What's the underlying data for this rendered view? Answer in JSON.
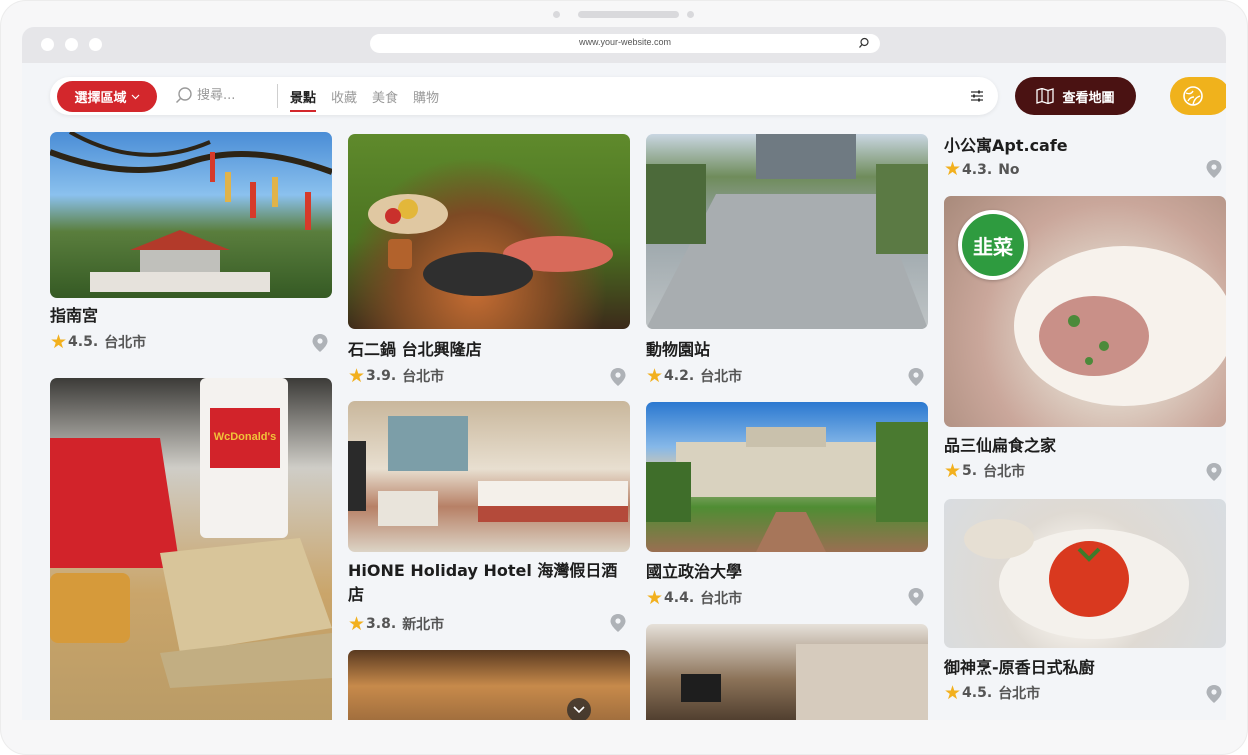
{
  "browser": {
    "url": "www.your-website.com"
  },
  "toolbar": {
    "region_button": "選擇區域",
    "search_placeholder": "搜尋...",
    "tabs": [
      {
        "label": "景點"
      },
      {
        "label": "收藏"
      },
      {
        "label": "美食"
      },
      {
        "label": "購物"
      }
    ],
    "map_button": "查看地圖"
  },
  "colors": {
    "accent_red": "#d3272c",
    "map_button": "#4a1212",
    "yellow_button": "#f0b21c",
    "star": "#f2b01e",
    "badge_green": "#2e9b3f"
  },
  "cards": [
    {
      "title": "指南宮",
      "rating": "4.5",
      "sep": ".",
      "city": "台北市"
    },
    {
      "title": "石二鍋 台北興隆店",
      "rating": "3.9",
      "sep": ".",
      "city": "台北市"
    },
    {
      "title": "動物園站",
      "rating": "4.2",
      "sep": ".",
      "city": "台北市"
    },
    {
      "title": "小公寓Apt.cafe",
      "rating": "4.3",
      "sep": ".",
      "city": "No"
    },
    {
      "title": "HiONE Holiday Hotel 海灣假日酒店",
      "rating": "3.8",
      "sep": ".",
      "city": "新北市"
    },
    {
      "title": "國立政治大學",
      "rating": "4.4",
      "sep": ".",
      "city": "台北市"
    },
    {
      "title": "品三仙扁食之家",
      "rating": "5",
      "sep": ".",
      "city": "台北市"
    },
    {
      "title": "御神烹-原香日式私廚",
      "rating": "4.5",
      "sep": ".",
      "city": "台北市"
    }
  ],
  "badge": {
    "label": "韭菜"
  },
  "icons": {
    "search": "search-icon",
    "chevron": "chevron-down-icon",
    "filter": "filter-icon",
    "map": "map-icon",
    "pin": "location-pin-icon",
    "star": "star-icon"
  }
}
